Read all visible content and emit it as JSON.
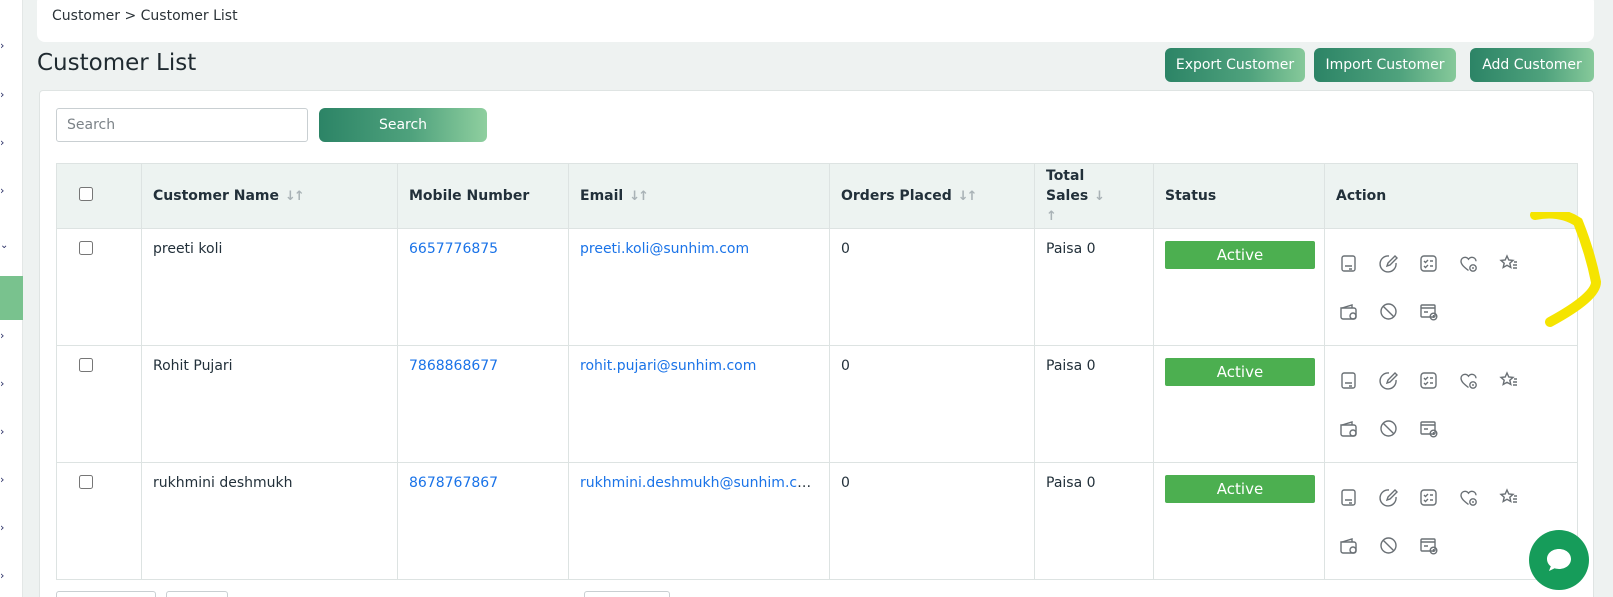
{
  "breadcrumb": "Customer > Customer List",
  "page_title": "Customer List",
  "buttons": {
    "export": "Export Customer",
    "import": "Import Customer",
    "add": "Add Customer"
  },
  "search": {
    "placeholder": "Search",
    "button": "Search"
  },
  "table": {
    "headers": {
      "name": "Customer Name",
      "mobile": "Mobile Number",
      "email": "Email",
      "orders": "Orders Placed",
      "sales": "Total Sales",
      "status": "Status",
      "action": "Action"
    },
    "rows": [
      {
        "name": "preeti koli",
        "mobile": "6657776875",
        "email": "preeti.koli@sunhim.com",
        "orders": "0",
        "sales": "Paisa 0",
        "status": "Active"
      },
      {
        "name": "Rohit Pujari",
        "mobile": "7868868677",
        "email": "rohit.pujari@sunhim.com",
        "orders": "0",
        "sales": "Paisa 0",
        "status": "Active"
      },
      {
        "name": "rukhmini deshmukh",
        "mobile": "8678767867",
        "email": "rukhmini.deshmukh@sunhim.com",
        "orders": "0",
        "sales": "Paisa 0",
        "status": "Active"
      }
    ]
  },
  "action_icons": [
    "view-icon",
    "edit-icon",
    "checklist-icon",
    "heart-icon",
    "star-icon",
    "wallet-icon",
    "block-icon",
    "billing-icon"
  ],
  "colors": {
    "accent": "#2c8466",
    "status_active": "#4caf50",
    "link": "#1a73e8",
    "highlight": "#f5e400",
    "chat": "#169c5a"
  }
}
